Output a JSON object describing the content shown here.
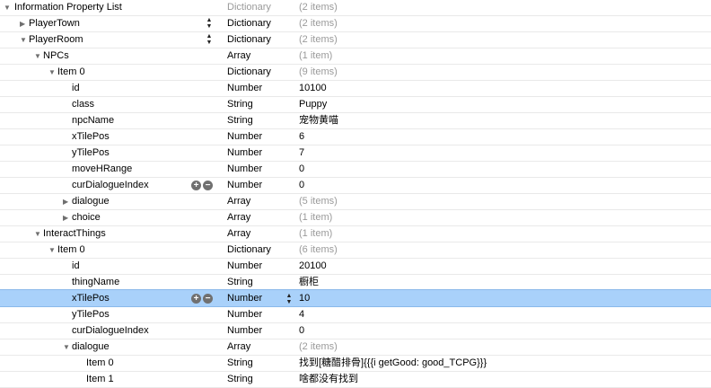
{
  "rows": [
    {
      "key": "Information Property List",
      "type": "Dictionary",
      "value": "(2 items)",
      "dim": true,
      "typeDim": true
    },
    {
      "key": "PlayerTown",
      "type": "Dictionary",
      "value": "(2 items)",
      "dim": true
    },
    {
      "key": "PlayerRoom",
      "type": "Dictionary",
      "value": "(2 items)",
      "dim": true
    },
    {
      "key": "NPCs",
      "type": "Array",
      "value": "(1 item)",
      "dim": true
    },
    {
      "key": "Item 0",
      "type": "Dictionary",
      "value": "(9 items)",
      "dim": true
    },
    {
      "key": "id",
      "type": "Number",
      "value": "10100"
    },
    {
      "key": "class",
      "type": "String",
      "value": "Puppy"
    },
    {
      "key": "npcName",
      "type": "String",
      "value": "宠物黄喵"
    },
    {
      "key": "xTilePos",
      "type": "Number",
      "value": "6"
    },
    {
      "key": "yTilePos",
      "type": "Number",
      "value": "7"
    },
    {
      "key": "moveHRange",
      "type": "Number",
      "value": "0"
    },
    {
      "key": "curDialogueIndex",
      "type": "Number",
      "value": "0"
    },
    {
      "key": "dialogue",
      "type": "Array",
      "value": "(5 items)",
      "dim": true
    },
    {
      "key": "choice",
      "type": "Array",
      "value": "(1 item)",
      "dim": true
    },
    {
      "key": "InteractThings",
      "type": "Array",
      "value": "(1 item)",
      "dim": true
    },
    {
      "key": "Item 0",
      "type": "Dictionary",
      "value": "(6 items)",
      "dim": true
    },
    {
      "key": "id",
      "type": "Number",
      "value": "20100"
    },
    {
      "key": "thingName",
      "type": "String",
      "value": "橱柜"
    },
    {
      "key": "xTilePos",
      "type": "Number",
      "value": "10"
    },
    {
      "key": "yTilePos",
      "type": "Number",
      "value": "4"
    },
    {
      "key": "curDialogueIndex",
      "type": "Number",
      "value": "0"
    },
    {
      "key": "dialogue",
      "type": "Array",
      "value": "(2 items)",
      "dim": true
    },
    {
      "key": "Item 0",
      "type": "String",
      "value": "找到[糖醋排骨]{{{i getGood: good_TCPG}}}"
    },
    {
      "key": "Item 1",
      "type": "String",
      "value": "啥都没有找到"
    }
  ],
  "icons": {
    "expanded": "disclosure-expanded-icon",
    "collapsed": "disclosure-collapsed-icon",
    "add": "plus-icon",
    "remove": "minus-icon",
    "sort": "sort-arrows-icon",
    "stepper": "stepper-arrows-icon"
  }
}
